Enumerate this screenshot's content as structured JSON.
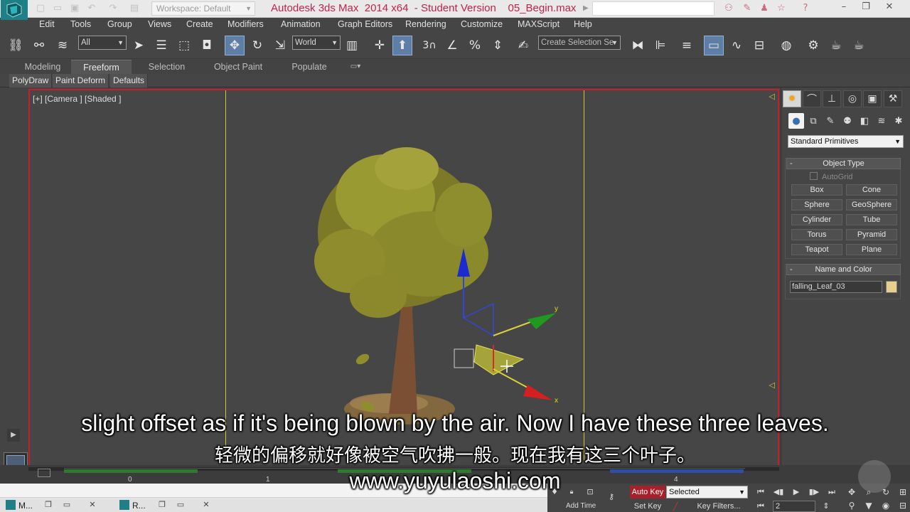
{
  "titlebar": {
    "workspace": "Workspace: Default",
    "title": "Autodesk 3ds Max  2014 x64  - Student Version    05_Begin.max"
  },
  "menu": [
    "Edit",
    "Tools",
    "Group",
    "Views",
    "Create",
    "Modifiers",
    "Animation",
    "Graph Editors",
    "Rendering",
    "Customize",
    "MAXScript",
    "Help"
  ],
  "toolbar": {
    "filter_select": "All",
    "reference_coord": "World",
    "snap_3": "3",
    "named_selection_placeholder": "Create Selection Se"
  },
  "ribbon": {
    "tabs": [
      "Modeling",
      "Freeform",
      "Selection",
      "Object Paint",
      "Populate"
    ],
    "active_tab": "Freeform",
    "panels": [
      "PolyDraw",
      "Paint Deform",
      "Defaults"
    ]
  },
  "viewport": {
    "label": "[+] [Camera ] [Shaded ]",
    "border_color": "#c61f2c",
    "gizmo_axes": [
      "y",
      "x"
    ]
  },
  "command_panel": {
    "category": "Standard Primitives",
    "object_type_title": "Object Type",
    "autogrid": "AutoGrid",
    "buttons": [
      "Box",
      "Cone",
      "Sphere",
      "GeoSphere",
      "Cylinder",
      "Tube",
      "Torus",
      "Pyramid",
      "Teapot",
      "Plane"
    ],
    "name_color_title": "Name and Color",
    "object_name": "falling_Leaf_03",
    "object_color": "#e6cf8c"
  },
  "timeline": {
    "ticks": [
      "0",
      "1",
      "4"
    ]
  },
  "animation": {
    "auto_key": "Auto Key",
    "key_mode": "Selected",
    "set_key": "Set Key",
    "key_filters": "Key Filters...",
    "add_time_tag": "Add Time",
    "current_frame": "2"
  },
  "taskbar": {
    "items": [
      "M...",
      "R..."
    ]
  },
  "subtitles": {
    "english": "slight offset as if it's being blown by the air. Now I have these three leaves.",
    "chinese": "轻微的偏移就好像被空气吹拂一般。现在我有这三个叶子。",
    "website": "www.yuyulaoshi.com"
  }
}
